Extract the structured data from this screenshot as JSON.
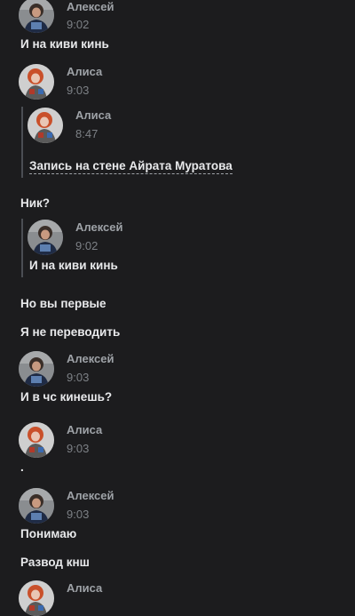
{
  "messages": [
    {
      "author": "Алексей",
      "time": "9:02",
      "text": "И на киви кинь"
    },
    {
      "author": "Алиса",
      "time": "9:03"
    },
    {
      "author": "Алексей",
      "time": "9:03",
      "text": "И в чс кинешь?"
    },
    {
      "author": "Алиса",
      "time": "9:03",
      "text": "."
    },
    {
      "author": "Алексей",
      "time": "9:03",
      "text": "Понимаю"
    },
    {
      "author": "Алиса"
    }
  ],
  "forwarded": {
    "author": "Алиса",
    "time": "8:47",
    "wall_post_link": "Запись на стене Айрата Муратова"
  },
  "msg2_text": "Ник?",
  "reply": {
    "author": "Алексей",
    "time": "9:02",
    "text": "И на киви кинь"
  },
  "extra_lines": [
    "Но вы первые",
    "Я не переводить",
    "Развод кнш"
  ],
  "icons": {
    "alexey_avatar": "avatar-alexey",
    "alisa_avatar": "avatar-alisa"
  }
}
